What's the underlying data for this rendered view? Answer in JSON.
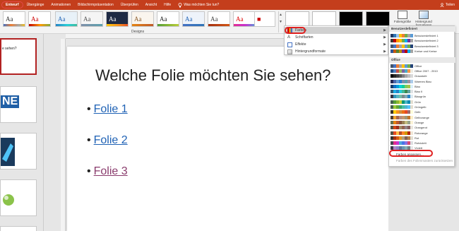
{
  "tabs": [
    {
      "label": "Entwurf",
      "active": true
    },
    {
      "label": "Übergänge"
    },
    {
      "label": "Animationen"
    },
    {
      "label": "Bildschirmpräsentation"
    },
    {
      "label": "Überprüfen"
    },
    {
      "label": "Ansicht"
    },
    {
      "label": "Hilfe"
    }
  ],
  "tellme": "Was möchten Sie tun?",
  "share": "Teilen",
  "ribbon": {
    "designs_label": "Designs",
    "slide_size_label": "Foliengröße",
    "background_label": "Hintergrund formatieren"
  },
  "menu": {
    "items": [
      "Farben",
      "Schriftarten",
      "Effekte",
      "Hintergrundformate"
    ]
  },
  "submenu": {
    "custom_header": "Benutzerdefiniert",
    "custom": [
      {
        "name": "Benutzerdefiniert 1",
        "colors": [
          "#1f3864",
          "#2e75b6",
          "#9dc3e6",
          "#ffc000",
          "#ed7d31",
          "#70ad47",
          "#a5a5a5",
          "#5b9bd5"
        ]
      },
      {
        "name": "Benutzerdefiniert 2",
        "colors": [
          "#3b3838",
          "#c00000",
          "#ff9900",
          "#ffc000",
          "#70ad47",
          "#00b0f0",
          "#7030a0",
          "#a5a5a5"
        ]
      },
      {
        "name": "Benutzerdefiniert 3",
        "colors": [
          "#44546a",
          "#4472c4",
          "#ed7d31",
          "#a5a5a5",
          "#ffc000",
          "#5b9bd5",
          "#70ad47",
          "#264478"
        ]
      },
      {
        "name": "Kreise und Kreise",
        "colors": [
          "#2f5597",
          "#c55a11",
          "#548235",
          "#bf9000",
          "#7030a0",
          "#c00000",
          "#00b0f0",
          "#a5a5a5"
        ]
      }
    ],
    "office_header": "Office",
    "office": [
      {
        "name": "Office",
        "colors": [
          "#44546a",
          "#4472c4",
          "#ed7d31",
          "#a5a5a5",
          "#ffc000",
          "#5b9bd5",
          "#70ad47",
          "#264478"
        ]
      },
      {
        "name": "Office 2007 - 2010",
        "colors": [
          "#1f497d",
          "#4f81bd",
          "#c0504d",
          "#9bbb59",
          "#8064a2",
          "#4bacc6",
          "#f79646",
          "#eeece1"
        ]
      },
      {
        "name": "Graustufe",
        "colors": [
          "#000000",
          "#262626",
          "#404040",
          "#595959",
          "#7f7f7f",
          "#a5a5a5",
          "#bfbfbf",
          "#d9d9d9"
        ]
      },
      {
        "name": "Warmes Blau",
        "colors": [
          "#242852",
          "#4a66ac",
          "#629dd1",
          "#297fd5",
          "#7f8fa9",
          "#5aa2ae",
          "#9d90a0",
          "#acccea"
        ]
      },
      {
        "name": "Blau",
        "colors": [
          "#17406d",
          "#0f6fc6",
          "#009dd9",
          "#0bd0d9",
          "#10cf9b",
          "#7cca62",
          "#a5c249",
          "#dbeff9"
        ]
      },
      {
        "name": "Blau II",
        "colors": [
          "#335b74",
          "#1cade4",
          "#2683c6",
          "#27ced7",
          "#42ba97",
          "#3e8853",
          "#62a39f",
          "#dfe3e5"
        ]
      },
      {
        "name": "Blaugrün",
        "colors": [
          "#373545",
          "#3494ba",
          "#58b6c0",
          "#75bda7",
          "#7a8c8e",
          "#84acb6",
          "#2683c6",
          "#dceaf1"
        ]
      },
      {
        "name": "Grün",
        "colors": [
          "#455f51",
          "#549e39",
          "#8ab833",
          "#c0cf3a",
          "#029676",
          "#4ab5c4",
          "#0989b1",
          "#e3ded1"
        ]
      },
      {
        "name": "Grüngelb",
        "colors": [
          "#455f51",
          "#99cb38",
          "#63a537",
          "#37a76f",
          "#44c1a3",
          "#4eb3cf",
          "#51c3f9",
          "#e3ded1"
        ]
      },
      {
        "name": "Gelb",
        "colors": [
          "#39302a",
          "#ffca08",
          "#f8931d",
          "#ce8d3e",
          "#ec7016",
          "#e64823",
          "#9c6a6a",
          "#fffed8"
        ]
      },
      {
        "name": "Gelborange",
        "colors": [
          "#4e3b30",
          "#f0a22e",
          "#a5644e",
          "#b58b80",
          "#c3986d",
          "#a19574",
          "#c17529",
          "#fbeec9"
        ]
      },
      {
        "name": "Orange",
        "colors": [
          "#637052",
          "#e48312",
          "#bd582c",
          "#865640",
          "#9b8357",
          "#c2bc80",
          "#94a088",
          "#fcf3d7"
        ]
      },
      {
        "name": "Orangerot",
        "colors": [
          "#505046",
          "#d34817",
          "#9b2d1f",
          "#a28e6a",
          "#956251",
          "#918485",
          "#855d5d",
          "#e9e5dc"
        ]
      },
      {
        "name": "Rotorange",
        "colors": [
          "#505046",
          "#e84c22",
          "#ffbd47",
          "#b64926",
          "#ff8427",
          "#cc9900",
          "#b22600",
          "#f0e6d6"
        ]
      },
      {
        "name": "Rot",
        "colors": [
          "#323232",
          "#a5300f",
          "#d55816",
          "#e19825",
          "#b19c7d",
          "#7f5f52",
          "#b27d49",
          "#e3ded1"
        ]
      },
      {
        "name": "Rotviolett",
        "colors": [
          "#454551",
          "#e32d91",
          "#c830cc",
          "#4ea6dc",
          "#4775e7",
          "#8971e1",
          "#d54773",
          "#dedee0"
        ]
      },
      {
        "name": "Violett",
        "colors": [
          "#373545",
          "#ad84c6",
          "#8784c7",
          "#5d739a",
          "#6997af",
          "#84acb6",
          "#6f8183",
          "#e7e6e8"
        ]
      }
    ],
    "customize": "Farben anpassen...",
    "reset": "Farben des Folienmasters zurücksetzen"
  },
  "thumbnails": [
    {
      "text": "e sehen?"
    },
    {
      "text": "NE"
    }
  ],
  "slide": {
    "title": "Welche Folie möchten Sie sehen?",
    "bullets": [
      {
        "label": "Folie 1",
        "visited": false
      },
      {
        "label": "Folie 2",
        "visited": false
      },
      {
        "label": "Folie 3",
        "visited": true
      }
    ]
  }
}
